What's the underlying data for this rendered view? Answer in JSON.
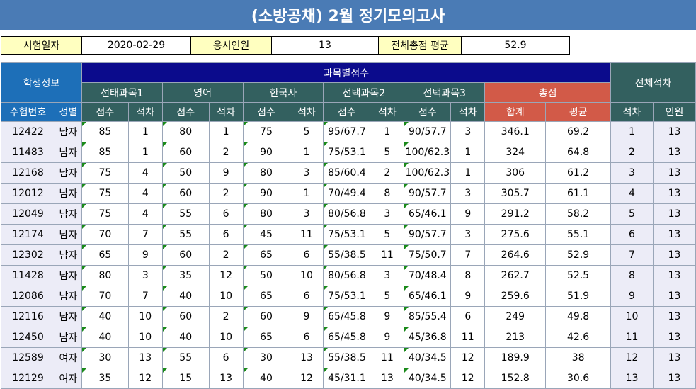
{
  "title": "(소방공채) 2월 정기모의고사",
  "info": {
    "date_label": "시험일자",
    "date_value": "2020-02-29",
    "count_label": "응시인원",
    "count_value": "13",
    "avg_label": "전체총점 평균",
    "avg_value": "52.9"
  },
  "headers": {
    "student_info": "학생정보",
    "subject_scores": "과목별점수",
    "overall_rank": "전체석차",
    "subjects": [
      "선태과목1",
      "영어",
      "한국사",
      "선택과목2",
      "선택과목3"
    ],
    "total": "총점",
    "exam_no": "수험번호",
    "gender": "성별",
    "score": "점수",
    "rank": "석차",
    "sum": "합계",
    "average": "평균",
    "overall_rank_col": "석차",
    "people": "인원"
  },
  "rows": [
    [
      "12422",
      "남자",
      "85",
      "1",
      "80",
      "1",
      "75",
      "5",
      "95/67.7",
      "1",
      "90/57.7",
      "3",
      "346.1",
      "69.2",
      "1",
      "13"
    ],
    [
      "11483",
      "남자",
      "85",
      "1",
      "60",
      "2",
      "90",
      "1",
      "75/53.1",
      "5",
      "100/62.3",
      "1",
      "324",
      "64.8",
      "2",
      "13"
    ],
    [
      "12168",
      "남자",
      "75",
      "4",
      "50",
      "9",
      "80",
      "3",
      "85/60.4",
      "2",
      "100/62.3",
      "1",
      "306",
      "61.2",
      "3",
      "13"
    ],
    [
      "12012",
      "남자",
      "75",
      "4",
      "60",
      "2",
      "90",
      "1",
      "70/49.4",
      "8",
      "90/57.7",
      "3",
      "305.7",
      "61.1",
      "4",
      "13"
    ],
    [
      "12049",
      "남자",
      "75",
      "4",
      "55",
      "6",
      "80",
      "3",
      "80/56.8",
      "3",
      "65/46.1",
      "9",
      "291.2",
      "58.2",
      "5",
      "13"
    ],
    [
      "12174",
      "남자",
      "70",
      "7",
      "55",
      "6",
      "45",
      "11",
      "75/53.1",
      "5",
      "90/57.7",
      "3",
      "275.6",
      "55.1",
      "6",
      "13"
    ],
    [
      "12302",
      "남자",
      "65",
      "9",
      "60",
      "2",
      "65",
      "6",
      "55/38.5",
      "11",
      "75/50.7",
      "7",
      "264.6",
      "52.9",
      "7",
      "13"
    ],
    [
      "11428",
      "남자",
      "80",
      "3",
      "35",
      "12",
      "50",
      "10",
      "80/56.8",
      "3",
      "70/48.4",
      "8",
      "262.7",
      "52.5",
      "8",
      "13"
    ],
    [
      "12086",
      "남자",
      "70",
      "7",
      "40",
      "10",
      "65",
      "6",
      "75/53.1",
      "5",
      "65/46.1",
      "9",
      "259.6",
      "51.9",
      "9",
      "13"
    ],
    [
      "12116",
      "남자",
      "40",
      "10",
      "60",
      "2",
      "60",
      "9",
      "65/45.8",
      "9",
      "85/55.4",
      "6",
      "249",
      "49.8",
      "10",
      "13"
    ],
    [
      "12450",
      "남자",
      "40",
      "10",
      "40",
      "10",
      "65",
      "6",
      "65/45.8",
      "9",
      "45/36.8",
      "11",
      "213",
      "42.6",
      "11",
      "13"
    ],
    [
      "12589",
      "여자",
      "30",
      "13",
      "55",
      "6",
      "30",
      "13",
      "55/38.5",
      "11",
      "40/34.5",
      "12",
      "189.9",
      "38",
      "12",
      "13"
    ],
    [
      "12129",
      "여자",
      "35",
      "12",
      "15",
      "13",
      "40",
      "12",
      "45/31.1",
      "13",
      "40/34.5",
      "12",
      "152.8",
      "30.6",
      "13",
      "13"
    ]
  ]
}
